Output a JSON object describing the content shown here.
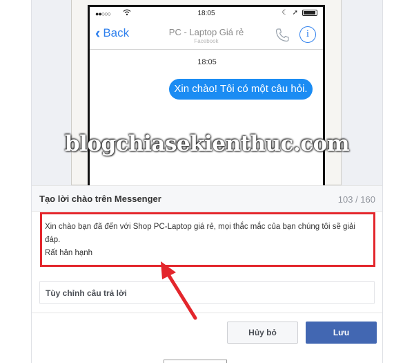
{
  "phone": {
    "status": {
      "time": "18:05",
      "signal_dots": "●●○○○"
    },
    "nav": {
      "back_label": "Back",
      "title": "PC - Laptop Giá rẻ",
      "subtitle": "Facebook",
      "info_glyph": "i"
    },
    "chat": {
      "time": "18:05",
      "bubble_text": "Xin chào! Tôi có một câu hỏi."
    }
  },
  "watermark": "blogchiasekienthuc.com",
  "panel": {
    "title": "Tạo lời chào trên Messenger",
    "char_count": "103 / 160",
    "greeting_line1": "Xin chào bạn đã đến với Shop PC-Laptop giá rẻ, mọi thắc mắc của bạn chúng tôi sẽ giải",
    "greeting_line2": "đáp.",
    "greeting_line3": "Rất hân hạnh",
    "customize_link": "Tùy chỉnh câu trả lời",
    "cancel_label": "Hủy bỏ",
    "save_label": "Lưu"
  },
  "colors": {
    "accent": "#1b8cf3",
    "save_button": "#4267b2",
    "highlight": "#e3262c"
  }
}
